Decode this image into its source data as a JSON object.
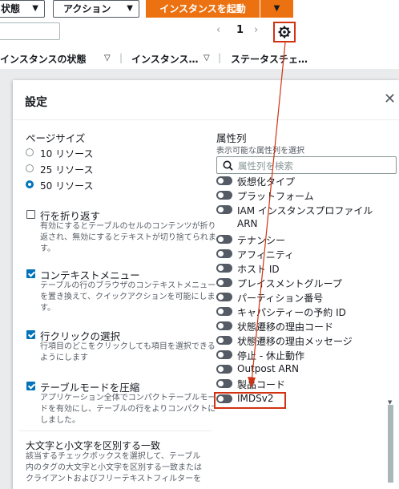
{
  "toolbar": {
    "state_button": "状態",
    "actions_button": "アクション",
    "launch_button": "インスタンスを起動",
    "page_number": "1"
  },
  "table_header": {
    "col_state": "インスタンスの状態",
    "col_type": "インスタンス…",
    "col_status": "ステータスチェ…"
  },
  "modal": {
    "title": "設定",
    "page_size": {
      "title": "ページサイズ",
      "options": [
        "10 リソース",
        "25 リソース",
        "50 リソース"
      ],
      "selected": "50 リソース"
    },
    "wrap_lines": {
      "label": "行を折り返す",
      "checked": false,
      "desc": "有効にするとテーブルのセルのコンテンツが折り返され、無効にするとテキストが切り捨てられます。"
    },
    "context_menu": {
      "label": "コンテキストメニュー",
      "checked": true,
      "desc": "テーブルの行のブラウザのコンテキストメニューを置き換えて、クイックアクションを可能にします。"
    },
    "row_click": {
      "label": "行クリックの選択",
      "checked": true,
      "desc": "行項目のどこをクリックしても項目を選択できるようにします"
    },
    "compact_mode": {
      "label": "テーブルモードを圧縮",
      "checked": true,
      "desc": "アプリケーション全体でコンパクトテーブルモードを有効にし、テーブルの行をよりコンパクトにしました。"
    },
    "case_sensitive": {
      "title": "大文字と小文字を区別する一致",
      "desc": "該当するチェックボックスを選択して、テーブル内のタグの大文字と小文字を区別する一致またはクライアントおよびフリーテキストフィルターを"
    },
    "attributes": {
      "title": "属性列",
      "subtitle": "表示可能な属性列を選択",
      "search_placeholder": "属性列を検索",
      "items": [
        {
          "label": "仮想化タイプ",
          "enabled": false
        },
        {
          "label": "プラットフォーム",
          "enabled": false
        },
        {
          "label": "IAM インスタンスプロファイル",
          "label2": "ARN",
          "enabled": false
        },
        {
          "label": "テナンシー",
          "enabled": false
        },
        {
          "label": "アフィニティ",
          "enabled": false
        },
        {
          "label": "ホスト ID",
          "enabled": false
        },
        {
          "label": "プレイスメントグループ",
          "enabled": false
        },
        {
          "label": "パーティション番号",
          "enabled": false
        },
        {
          "label": "キャパシティーの予約 ID",
          "enabled": false
        },
        {
          "label": "状態遷移の理由コード",
          "enabled": false
        },
        {
          "label": "状態遷移の理由メッセージ",
          "enabled": false
        },
        {
          "label": "停止 - 休止動作",
          "enabled": false
        },
        {
          "label": "Outpost ARN",
          "enabled": false
        },
        {
          "label": "製品コード",
          "enabled": false
        },
        {
          "label": "IMDSv2",
          "enabled": false
        }
      ]
    }
  },
  "colors": {
    "accent": "#0073bb",
    "launch_orange": "#ec7211",
    "annotation_red": "#d13212"
  }
}
